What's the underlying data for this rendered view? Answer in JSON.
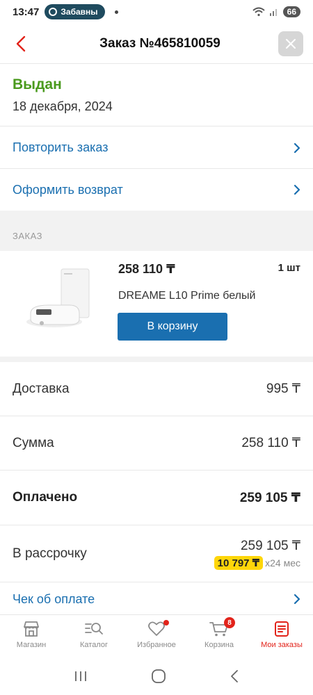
{
  "status_bar": {
    "time": "13:47",
    "pill_text": "Забавны",
    "battery": "66"
  },
  "header": {
    "title": "Заказ №465810059"
  },
  "order_status": {
    "title": "Выдан",
    "date": "18 декабря, 2024"
  },
  "actions": [
    {
      "label": "Повторить заказ"
    },
    {
      "label": "Оформить возврат"
    }
  ],
  "section": {
    "label": "ЗАКАЗ"
  },
  "product": {
    "price": "258 110 ₸",
    "quantity": "1 шт",
    "name": "DREAME L10 Prime белый",
    "cart_button": "В корзину"
  },
  "summary": {
    "delivery": {
      "label": "Доставка",
      "value": "995 ₸"
    },
    "sum": {
      "label": "Сумма",
      "value": "258 110 ₸"
    },
    "paid": {
      "label": "Оплачено",
      "value": "259 105 ₸"
    },
    "installment": {
      "label": "В рассрочку",
      "value": "259 105 ₸",
      "monthly": "10 797 ₸",
      "term": "x24 мес"
    }
  },
  "receipt": {
    "label": "Чек об оплате"
  },
  "bottom_nav": {
    "items": [
      {
        "label": "Магазин",
        "icon": "shop-icon"
      },
      {
        "label": "Каталог",
        "icon": "catalog-search-icon"
      },
      {
        "label": "Избранное",
        "icon": "heart-icon"
      },
      {
        "label": "Корзина",
        "icon": "cart-icon",
        "badge": "8"
      },
      {
        "label": "Мои заказы",
        "icon": "orders-icon"
      }
    ]
  },
  "colors": {
    "accent_blue": "#1a6fb0",
    "brand_red": "#e2231a",
    "status_green": "#4a9a1d",
    "highlight_yellow": "#ffd60a"
  }
}
